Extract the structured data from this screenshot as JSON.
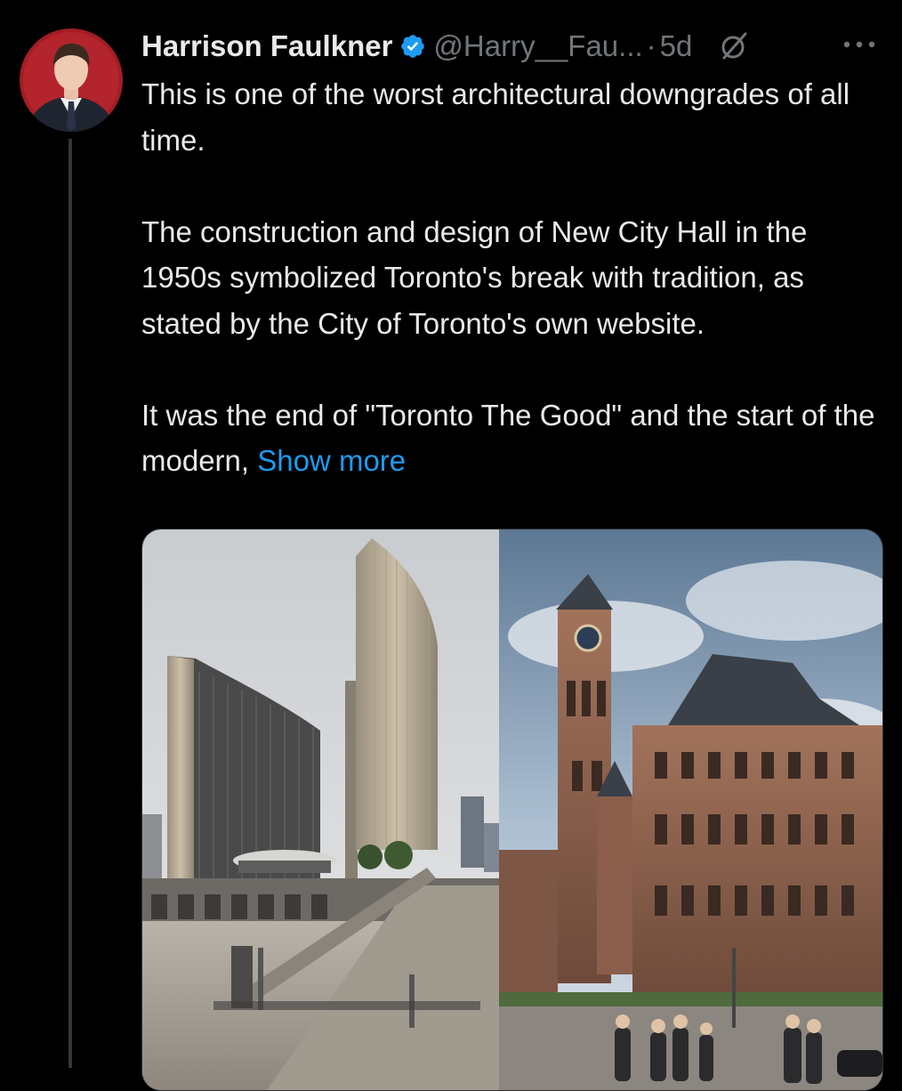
{
  "tweet": {
    "author": {
      "display_name": "Harrison Faulkner",
      "handle": "@Harry__Fau...",
      "verified": true,
      "avatar_bg": "#a31d24"
    },
    "separator": "·",
    "time": "5d",
    "text": {
      "line1": "This is one of the worst architectural downgrades of all time.",
      "line2": "The construction and design of New City Hall in the 1950s symbolized Toronto's break with tradition, as stated by the City of Toronto's own website.",
      "line3": "It was the end of \"Toronto The Good\" and the start of the modern,",
      "show_more": "Show more"
    },
    "media": [
      {
        "icon": "new-city-hall-photo"
      },
      {
        "icon": "old-city-hall-photo"
      }
    ]
  },
  "colors": {
    "background": "#000000",
    "text": "#e7e9ea",
    "secondary": "#71767b",
    "link": "#1d9bf0",
    "verified": "#1d9bf0"
  }
}
